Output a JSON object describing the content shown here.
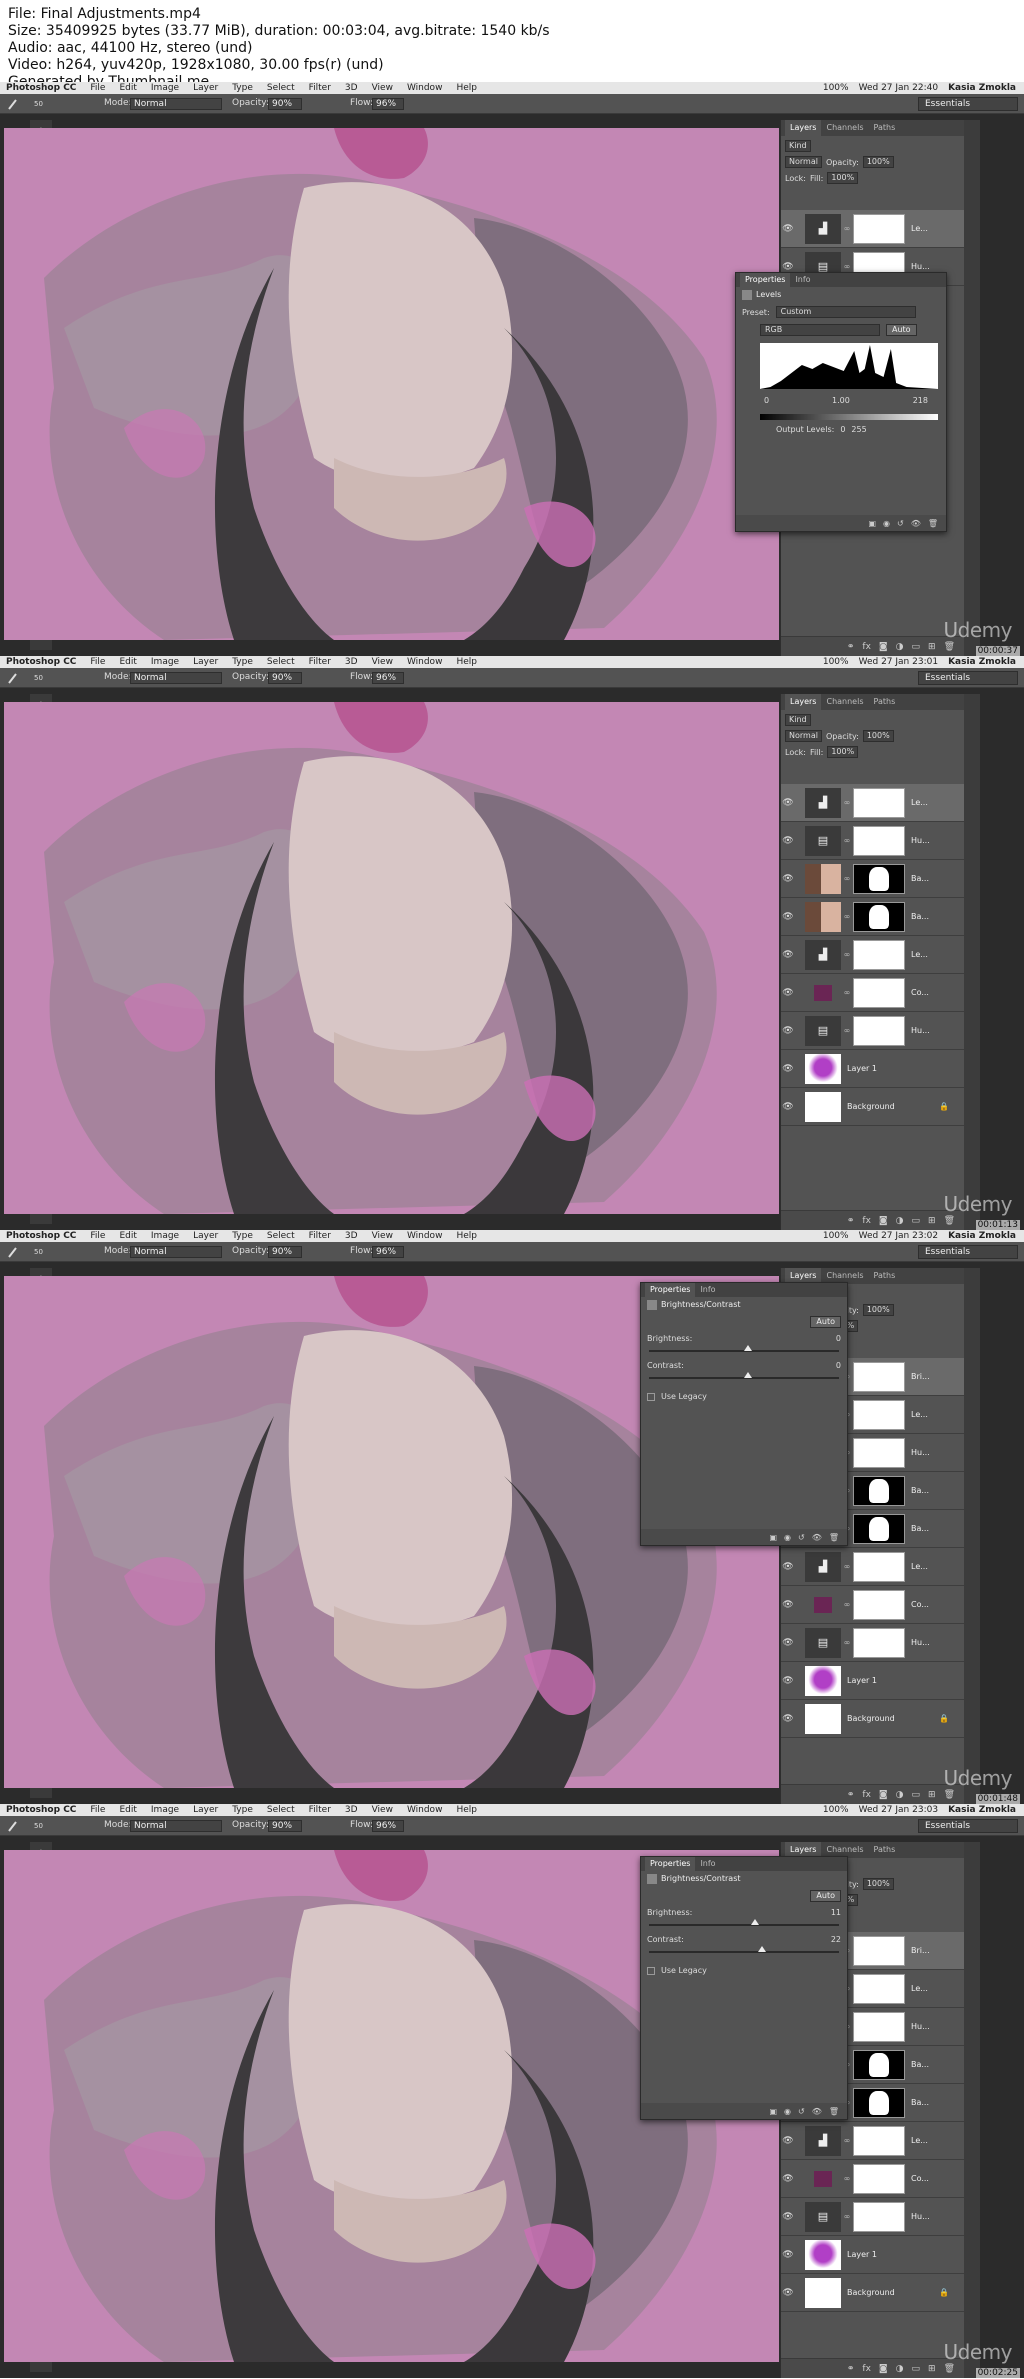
{
  "header": {
    "file_line": "File: Final Adjustments.mp4",
    "size_line": "Size: 35409925 bytes (33.77 MiB), duration: 00:03:04, avg.bitrate: 1540 kb/s",
    "audio_line": "Audio: aac, 44100 Hz, stereo (und)",
    "video_line": "Video: h264, yuv420p, 1928x1080, 30.00 fps(r) (und)",
    "generator_line": "Generated by Thumbnail me"
  },
  "menubar": {
    "app_name": "Photoshop CC",
    "items": [
      "File",
      "Edit",
      "Image",
      "Layer",
      "Type",
      "Select",
      "Filter",
      "3D",
      "View",
      "Window",
      "Help"
    ],
    "battery": "100%",
    "user": "Kasia Zmokla"
  },
  "optionsbar": {
    "brush_size": "50",
    "mode_label": "Mode:",
    "mode_value": "Normal",
    "opacity_label": "Opacity:",
    "opacity_value": "90%",
    "flow_label": "Flow:",
    "flow_value": "96%",
    "workspace": "Essentials"
  },
  "layers_panel": {
    "tabs": [
      "Layers",
      "Channels",
      "Paths"
    ],
    "filter_kind": "Kind",
    "blend_mode": "Normal",
    "opacity_label": "Opacity:",
    "opacity_value": "100%",
    "lock_label": "Lock:",
    "fill_label": "Fill:",
    "fill_value": "100%"
  },
  "frames": [
    {
      "clock": "Wed 27 Jan 22:40",
      "timecode": "00:00:37",
      "layers": [
        {
          "name": "Le...",
          "type": "levels",
          "selected": true
        },
        {
          "name": "Hu...",
          "type": "huesat",
          "selected": false
        }
      ],
      "levels": {
        "tabs": [
          "Properties",
          "Info"
        ],
        "title": "Levels",
        "preset_label": "Preset:",
        "preset_value": "Custom",
        "channel": "RGB",
        "auto_label": "Auto",
        "input_black": "0",
        "input_gamma": "1.00",
        "input_white": "218",
        "output_label": "Output Levels:",
        "output_black": "0",
        "output_white": "255"
      }
    },
    {
      "clock": "Wed 27 Jan 23:01",
      "timecode": "00:01:13",
      "layers": [
        {
          "name": "Le...",
          "type": "levels",
          "selected": true
        },
        {
          "name": "Hu...",
          "type": "huesat",
          "selected": false
        },
        {
          "name": "Ba...",
          "type": "photo",
          "selected": false
        },
        {
          "name": "Ba...",
          "type": "photo",
          "selected": false
        },
        {
          "name": "Le...",
          "type": "levels",
          "selected": false
        },
        {
          "name": "Co...",
          "type": "solid",
          "selected": false
        },
        {
          "name": "Hu...",
          "type": "huesat",
          "selected": false
        },
        {
          "name": "Layer 1",
          "type": "flower",
          "selected": false
        },
        {
          "name": "Background",
          "type": "background",
          "selected": false
        }
      ]
    },
    {
      "clock": "Wed 27 Jan 23:02",
      "timecode": "00:01:48",
      "layers": [
        {
          "name": "Bri...",
          "type": "bc",
          "selected": true
        },
        {
          "name": "Le...",
          "type": "levels",
          "selected": false
        },
        {
          "name": "Hu...",
          "type": "huesat",
          "selected": false
        },
        {
          "name": "Ba...",
          "type": "photo",
          "selected": false
        },
        {
          "name": "Ba...",
          "type": "photo",
          "selected": false
        },
        {
          "name": "Le...",
          "type": "levels",
          "selected": false
        },
        {
          "name": "Co...",
          "type": "solid",
          "selected": false
        },
        {
          "name": "Hu...",
          "type": "huesat",
          "selected": false
        },
        {
          "name": "Layer 1",
          "type": "flower",
          "selected": false
        },
        {
          "name": "Background",
          "type": "background",
          "selected": false
        }
      ],
      "bc": {
        "tabs": [
          "Properties",
          "Info"
        ],
        "title": "Brightness/Contrast",
        "auto_label": "Auto",
        "brightness_label": "Brightness:",
        "brightness_value": "0",
        "contrast_label": "Contrast:",
        "contrast_value": "0",
        "legacy_label": "Use Legacy"
      }
    },
    {
      "clock": "Wed 27 Jan 23:03",
      "timecode": "00:02:25",
      "layers": [
        {
          "name": "Bri...",
          "type": "bc",
          "selected": true
        },
        {
          "name": "Le...",
          "type": "levels",
          "selected": false
        },
        {
          "name": "Hu...",
          "type": "huesat",
          "selected": false
        },
        {
          "name": "Ba...",
          "type": "photo",
          "selected": false
        },
        {
          "name": "Ba...",
          "type": "photo",
          "selected": false
        },
        {
          "name": "Le...",
          "type": "levels",
          "selected": false
        },
        {
          "name": "Co...",
          "type": "solid",
          "selected": false
        },
        {
          "name": "Hu...",
          "type": "huesat",
          "selected": false
        },
        {
          "name": "Layer 1",
          "type": "flower",
          "selected": false
        },
        {
          "name": "Background",
          "type": "background",
          "selected": false
        }
      ],
      "bc": {
        "tabs": [
          "Properties",
          "Info"
        ],
        "title": "Brightness/Contrast",
        "auto_label": "Auto",
        "brightness_label": "Brightness:",
        "brightness_value": "11",
        "contrast_label": "Contrast:",
        "contrast_value": "22",
        "legacy_label": "Use Legacy"
      }
    }
  ],
  "watermark": "Udemy",
  "colors": {
    "canvas_pink": "#c387b4",
    "panel_gray": "#535353",
    "dark_chrome": "#2b2b2b"
  }
}
